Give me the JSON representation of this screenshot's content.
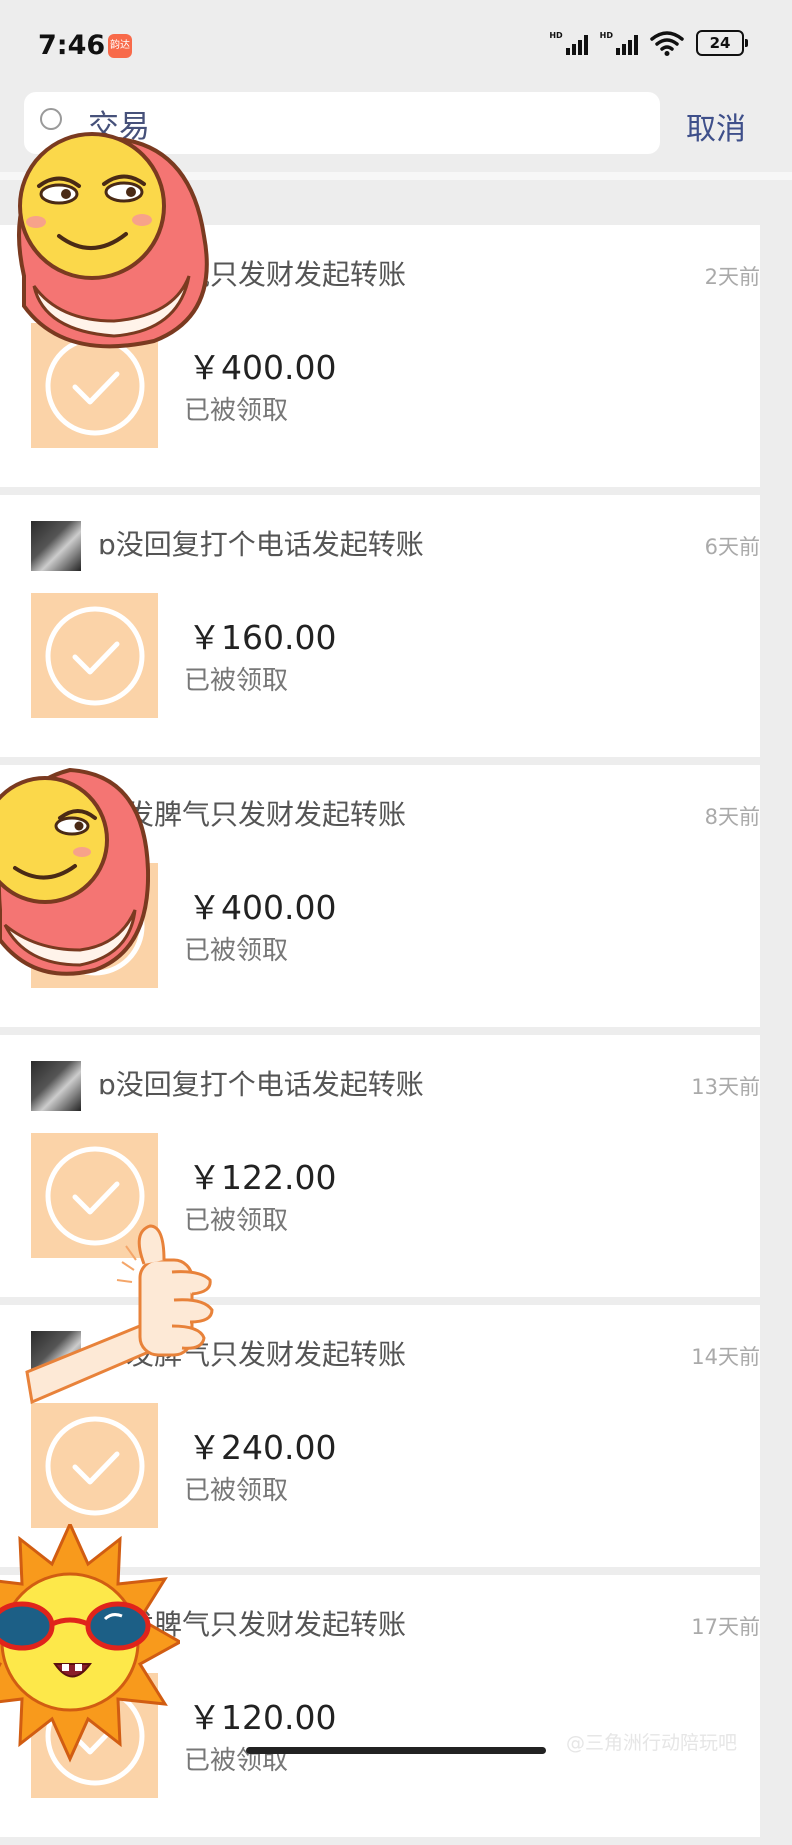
{
  "status_bar": {
    "time": "7:46",
    "app_badge": "韵达",
    "hd_label": "HD",
    "battery": "24"
  },
  "search": {
    "value": "交易",
    "placeholder": "",
    "cancel_label": "取消"
  },
  "transfers": [
    {
      "sender": "不发脾气只发财发起转账",
      "time": "2天前",
      "amount": "￥400.00",
      "status": "已被领取"
    },
    {
      "sender": "ɒ没回复打个电话发起转账",
      "time": "6天前",
      "amount": "￥160.00",
      "status": "已被领取"
    },
    {
      "sender": "不发脾气只发财发起转账",
      "time": "8天前",
      "amount": "￥400.00",
      "status": "已被领取"
    },
    {
      "sender": "ɒ没回复打个电话发起转账",
      "time": "13天前",
      "amount": "￥122.00",
      "status": "已被领取"
    },
    {
      "sender": "不发脾气只发财发起转账",
      "time": "14天前",
      "amount": "￥240.00",
      "status": "已被领取"
    },
    {
      "sender": "不发脾气只发财发起转账",
      "time": "17天前",
      "amount": "￥120.00",
      "status": "已被领取"
    }
  ],
  "watermark": "@三角洲行动陪玩吧",
  "colors": {
    "background": "#ededed",
    "card": "#ffffff",
    "tile": "#fbd3a8",
    "accent_text": "#3e4f8a"
  },
  "icons": [
    "search-icon",
    "check-circle-icon",
    "signal-icon",
    "wifi-icon",
    "battery-icon",
    "emoji-sticker",
    "thumbs-up-sticker",
    "sun-sticker"
  ]
}
